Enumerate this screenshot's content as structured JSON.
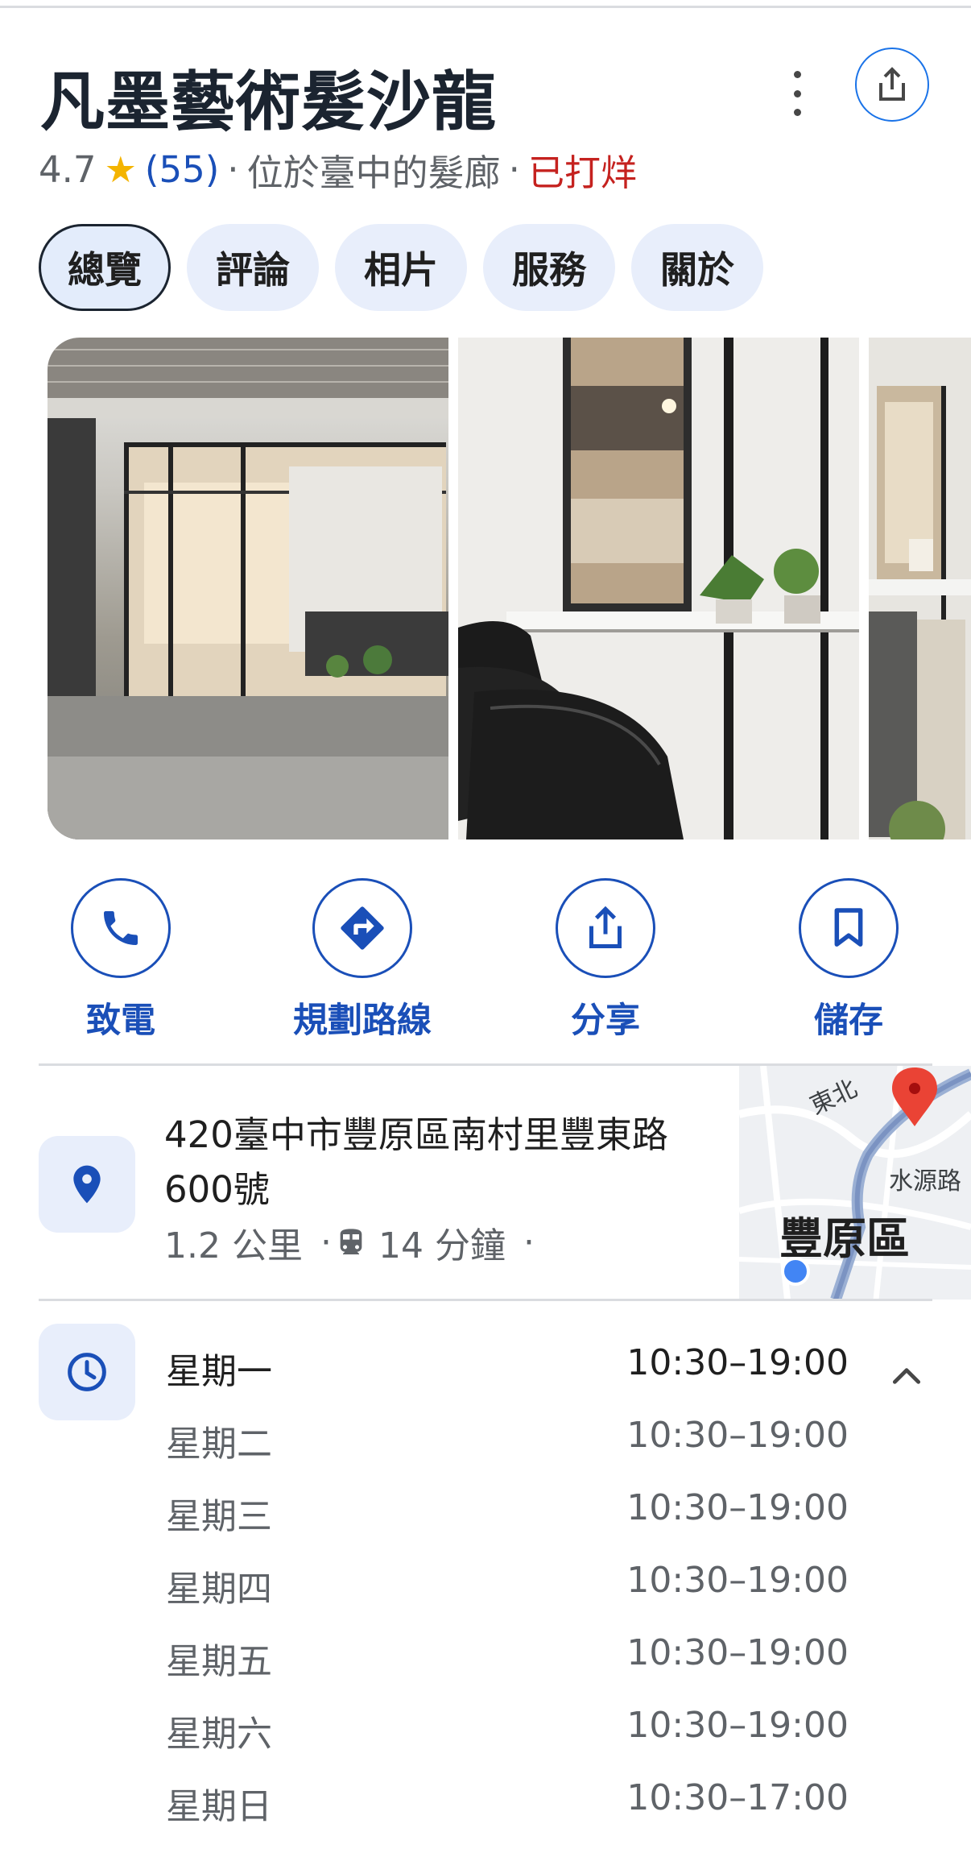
{
  "place": {
    "name": "凡墨藝術髮沙龍",
    "rating": "4.7",
    "review_count": "(55)",
    "sep1": "·",
    "category": "位於臺中的髮廊",
    "sep2": "·",
    "status": "已打烊"
  },
  "tabs": [
    {
      "label": "總覽",
      "active": true
    },
    {
      "label": "評論",
      "active": false
    },
    {
      "label": "相片",
      "active": false
    },
    {
      "label": "服務",
      "active": false
    },
    {
      "label": "關於",
      "active": false
    }
  ],
  "actions": [
    {
      "label": "致電",
      "icon": "phone-icon"
    },
    {
      "label": "規劃路線",
      "icon": "directions-icon"
    },
    {
      "label": "分享",
      "icon": "share-icon"
    },
    {
      "label": "儲存",
      "icon": "bookmark-icon"
    }
  ],
  "address": {
    "line1": "420臺中市豐原區南村里豐東路",
    "line2": "600號",
    "distance": "1.2 公里",
    "transit_time": "14 分鐘",
    "dot1": "·",
    "dot2": "·"
  },
  "map": {
    "label_east_north": "東北",
    "label_water": "水源路",
    "label_district": "豐原區"
  },
  "hours": [
    {
      "day": "星期一",
      "time": "10:30–19:00"
    },
    {
      "day": "星期二",
      "time": "10:30–19:00"
    },
    {
      "day": "星期三",
      "time": "10:30–19:00"
    },
    {
      "day": "星期四",
      "time": "10:30–19:00"
    },
    {
      "day": "星期五",
      "time": "10:30–19:00"
    },
    {
      "day": "星期六",
      "time": "10:30–19:00"
    },
    {
      "day": "星期日",
      "time": "10:30–17:00"
    }
  ],
  "colors": {
    "accent": "#1a4fb8",
    "star": "#f4b400",
    "closed": "#c5221f",
    "chip_bg": "#e8eefb"
  }
}
